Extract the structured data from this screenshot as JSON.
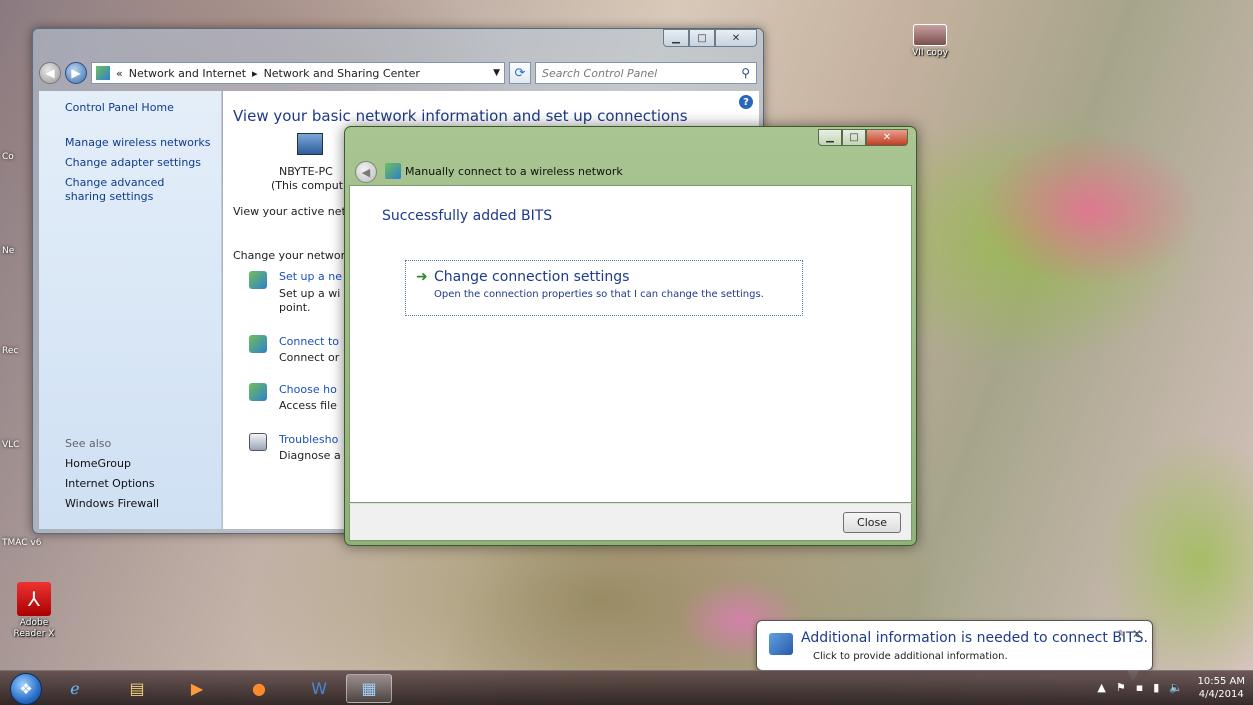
{
  "desktop": {
    "icons": [
      {
        "label": "VII copy"
      },
      {
        "label": "Adobe Reader X"
      }
    ],
    "edge_labels": [
      "Co",
      "Ne",
      "Rec",
      "VLC",
      "TMAC v6"
    ]
  },
  "control_panel": {
    "address": {
      "crumb_prefix": "«",
      "crumb1": "Network and Internet",
      "sep": "▸",
      "crumb2": "Network and Sharing Center"
    },
    "search_placeholder": "Search Control Panel",
    "sidebar": {
      "links": [
        "Control Panel Home",
        "Manage wireless networks",
        "Change adapter settings",
        "Change advanced sharing settings"
      ],
      "see_also_label": "See also",
      "see_also": [
        "HomeGroup",
        "Internet Options",
        "Windows Firewall"
      ]
    },
    "main": {
      "heading": "View your basic network information and set up connections",
      "computer_name": "NBYTE-PC",
      "computer_sub": "(This comput",
      "active_networks": "View your active netw",
      "change_networking": "Change your networ",
      "tasks": [
        {
          "link": "Set up a ne",
          "desc1": "Set up a wi",
          "desc2": "point."
        },
        {
          "link": "Connect to",
          "desc1": "Connect or",
          "desc2": ""
        },
        {
          "link": "Choose ho",
          "desc1": "Access file",
          "desc2": ""
        },
        {
          "link": "Troublesho",
          "desc1": "Diagnose a",
          "desc2": ""
        }
      ]
    }
  },
  "dialog": {
    "title": "Manually connect to a wireless network",
    "heading": "Successfully added BITS",
    "command": {
      "title": "Change connection settings",
      "description": "Open the connection properties so that I can change the settings."
    },
    "close_label": "Close"
  },
  "notification": {
    "title": "Additional information is needed to connect BITS.",
    "message": "Click to provide additional information."
  },
  "taskbar": {
    "clock_time": "10:55 AM",
    "clock_date": "4/4/2014"
  }
}
